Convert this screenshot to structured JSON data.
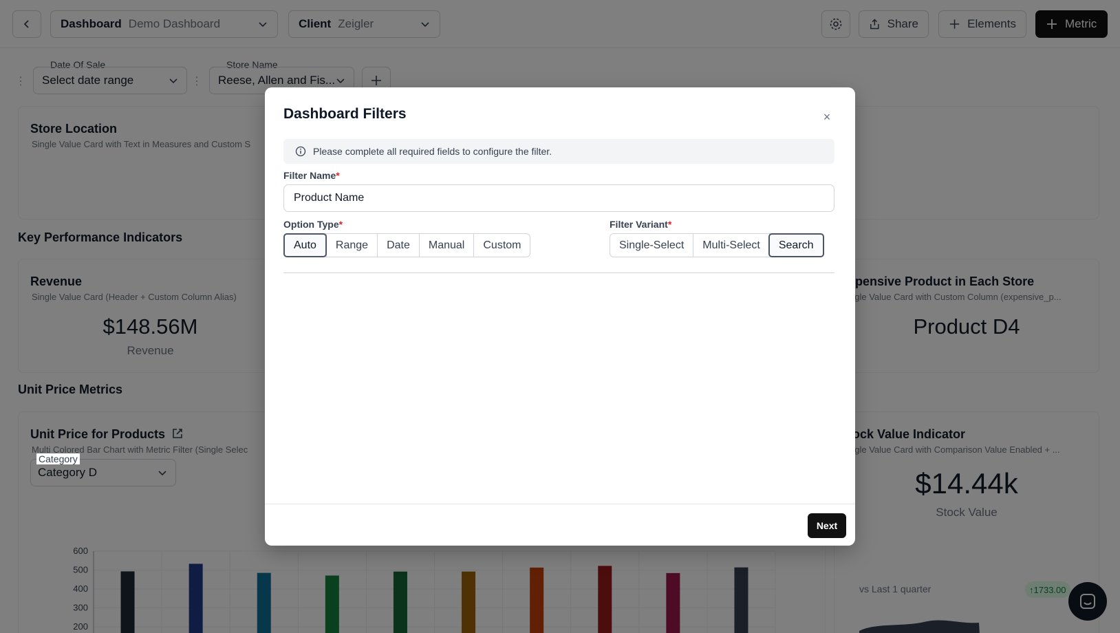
{
  "topbar": {
    "dashboard_label": "Dashboard",
    "dashboard_value": "Demo Dashboard",
    "client_label": "Client",
    "client_value": "Zeigler",
    "share_label": "Share",
    "elements_label": "Elements",
    "metric_label": "Metric"
  },
  "filters": {
    "date_label": "Date Of Sale",
    "date_value": "Select date range",
    "store_label": "Store Name",
    "store_value": "Reese, Allen and Fis..."
  },
  "cards": {
    "store_location": {
      "title": "Store Location",
      "subtitle": "Single Value Card with Text in Measures and Custom S"
    },
    "kpi_section": "Key Performance Indicators",
    "revenue": {
      "title": "Revenue",
      "subtitle": "Single Value Card (Header + Custom Column Alias)",
      "value": "$148.56M",
      "caption": "Revenue"
    },
    "expensive": {
      "title": "xpensive Product in Each Store",
      "subtitle": "ngle Value Card with Custom Column (expensive_p...",
      "value": "Product D4"
    },
    "unit_section": "Unit Price Metrics",
    "unit_price": {
      "title": "Unit Price for Products",
      "subtitle": "Multi Colored Bar Chart with Metric Filter (Single Selec",
      "category_label": "Category",
      "category_value": "Category D"
    },
    "stock": {
      "title": "tock Value Indicator",
      "subtitle": "ngle Value Card with Comparison Value Enabled + ...",
      "value": "$14.44k",
      "caption": "Stock Value",
      "comparison": "vs Last 1 quarter",
      "badge": "1733.00"
    }
  },
  "chart_data": {
    "type": "bar",
    "yticks": [
      600,
      500,
      400,
      300,
      200
    ],
    "ylim": [
      0,
      600
    ],
    "values": [
      493,
      533,
      485,
      471,
      492,
      492,
      513,
      522,
      484,
      514
    ],
    "colors": [
      "#1f2937",
      "#1e3a8a",
      "#0e6f94",
      "#15803d",
      "#166534",
      "#a16207",
      "#c2410c",
      "#991b1b",
      "#9d174d",
      "#374151"
    ]
  },
  "modal": {
    "title": "Dashboard Filters",
    "info_text": "Please complete all required fields to configure the filter.",
    "filter_name_label": "Filter Name",
    "filter_name_value": "Product Name",
    "option_type_label": "Option Type",
    "option_types": [
      "Auto",
      "Range",
      "Date",
      "Manual",
      "Custom"
    ],
    "option_type_selected": "Auto",
    "filter_variant_label": "Filter Variant",
    "filter_variants": [
      "Single-Select",
      "Multi-Select",
      "Search"
    ],
    "filter_variant_selected": "Search",
    "next_label": "Next",
    "required_marker": "*",
    "close_glyph": "×"
  }
}
